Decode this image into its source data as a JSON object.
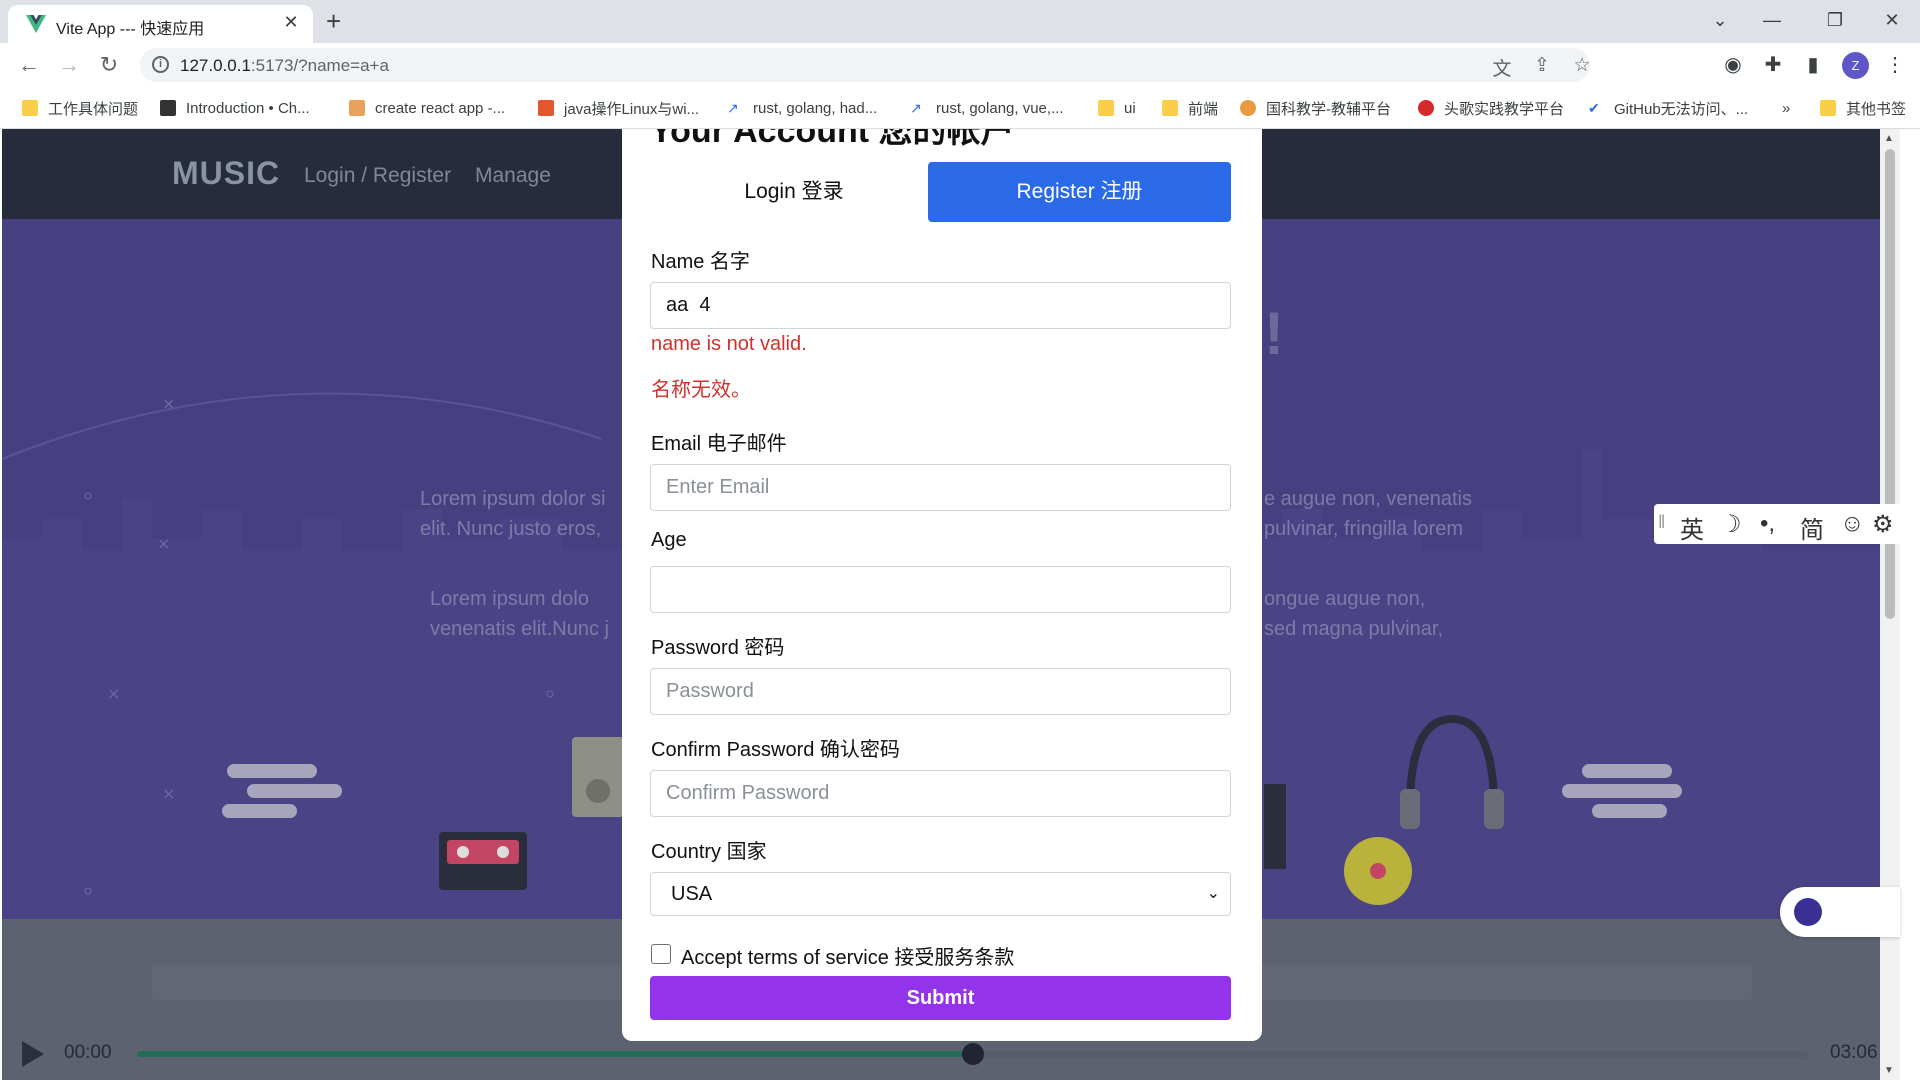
{
  "browser": {
    "tab_title": "Vite App --- 快速应用",
    "url_host": "127.0.0.1",
    "url_path": ":5173/?name=a+a",
    "avatar_letter": "Z",
    "bookmarks": [
      {
        "label": "工作具体问题",
        "icon": "folder-icon"
      },
      {
        "label": "Introduction • Ch...",
        "icon": "site-icon"
      },
      {
        "label": "create react app -...",
        "icon": "site-icon"
      },
      {
        "label": "java操作Linux与wi...",
        "icon": "site-icon"
      },
      {
        "label": "rust, golang, had...",
        "icon": "trend-icon"
      },
      {
        "label": "rust, golang, vue,...",
        "icon": "trend-icon"
      },
      {
        "label": "ui",
        "icon": "folder-icon"
      },
      {
        "label": "前端",
        "icon": "folder-icon"
      },
      {
        "label": "国科教学-教辅平台",
        "icon": "site-icon"
      },
      {
        "label": "头歌实践教学平台",
        "icon": "site-icon"
      },
      {
        "label": "GitHub无法访问、...",
        "icon": "site-icon"
      }
    ],
    "bookmarks_more": "»",
    "other_bookmarks": "其他书签"
  },
  "app": {
    "brand": "MUSIC",
    "nav": [
      "Login / Register",
      "Manage"
    ],
    "hero_left_1": "Lorem ipsum dolor si",
    "hero_left_2": "elit. Nunc justo eros,",
    "hero_left_3": "Lorem ipsum dolo",
    "hero_left_4": "venenatis elit.Nunc j",
    "hero_right_1": "e augue non, venenatis",
    "hero_right_2": "pulvinar, fringilla lorem",
    "hero_right_3": "ongue augue non,",
    "hero_right_4": "sed magna pulvinar,",
    "hero_bang": "!",
    "player": {
      "current": "00:00",
      "duration": "03:06",
      "progress": 0.5
    }
  },
  "modal": {
    "title": "Your Account 您的帐户",
    "tab_login": "Login 登录",
    "tab_register": "Register 注册",
    "name_label": "Name 名字",
    "name_value": "aa  4",
    "error_en": "name is not valid.",
    "error_zh": "名称无效。",
    "email_label": "Email 电子邮件",
    "email_placeholder": "Enter Email",
    "age_label": "Age",
    "password_label": "Password 密码",
    "password_placeholder": "Password",
    "confirm_label": "Confirm Password 确认密码",
    "confirm_placeholder": "Confirm Password",
    "country_label": "Country 国家",
    "country_value": "USA",
    "tos_label": "Accept terms of service 接受服务条款",
    "submit_label": "Submit"
  },
  "ime": {
    "lang": "英",
    "moon": "☽",
    "punct": "•,",
    "simp": "简",
    "emoji": "☺",
    "gear": "⚙"
  },
  "colors": {
    "accent": "#2a6ae9",
    "submit": "#9333ea",
    "error": "#d0312d",
    "hero": "#463f80",
    "header": "#262c3b"
  }
}
